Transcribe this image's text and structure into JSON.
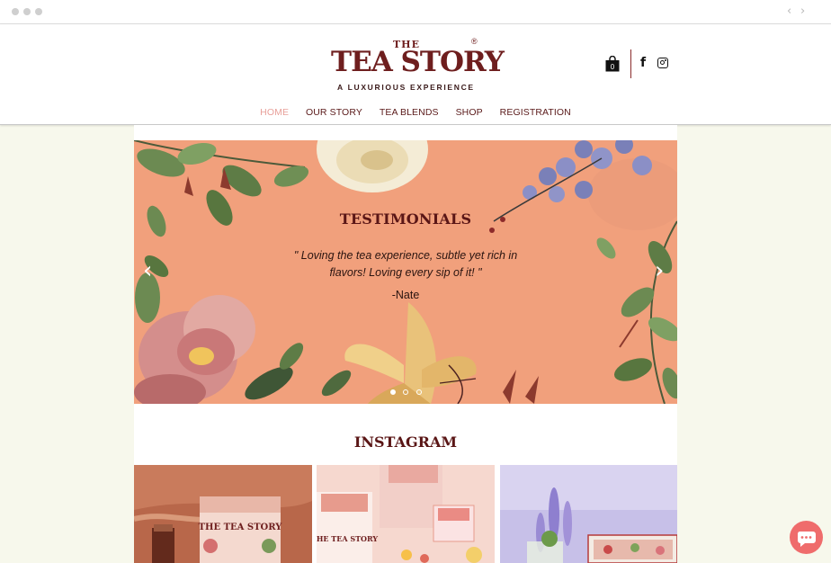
{
  "brand": {
    "the": "THE",
    "name": "TEA STORY",
    "reg": "®",
    "tagline": "A LUXURIOUS EXPERIENCE"
  },
  "header": {
    "cart_count": "0",
    "facebook_glyph": "f"
  },
  "menu": {
    "items": [
      {
        "label": "HOME",
        "active": true
      },
      {
        "label": "OUR STORY",
        "active": false
      },
      {
        "label": "TEA BLENDS",
        "active": false
      },
      {
        "label": "SHOP",
        "active": false
      },
      {
        "label": "REGISTRATION",
        "active": false
      }
    ]
  },
  "testimonials": {
    "title": "TESTIMONIALS",
    "quote": "\" Loving the tea experience, subtle yet rich in flavors! Loving every sip of it! \"",
    "author": "-Nate",
    "prev_glyph": "‹",
    "next_glyph": "›",
    "slide_count": 3,
    "active_slide": 1
  },
  "instagram": {
    "title": "INSTAGRAM",
    "thumb_texts": [
      "THE TEA STORY",
      "THE TEA STORY"
    ]
  },
  "colors": {
    "brand_maroon": "#6e1e1e",
    "menu_active": "#e8a09a",
    "slide_bg": "#f1a07c",
    "page_bg": "#f7f8ec",
    "chat": "#ef6c6c"
  },
  "icons": [
    "cart-icon",
    "facebook-icon",
    "instagram-icon",
    "chat-icon",
    "chevron-left-icon",
    "chevron-right-icon"
  ]
}
